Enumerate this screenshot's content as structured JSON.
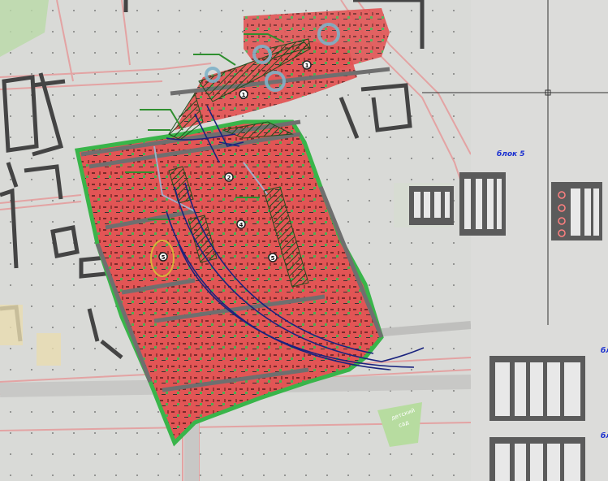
{
  "viewport": {
    "background": "#d6d6d4",
    "paper_color": "#dcdcda"
  },
  "colors": {
    "road_outline": "#e8a6a6",
    "building_outline": "#4a4a4a",
    "site_fill": "#e05a5a",
    "site_edge": "#2f8f2f",
    "hatch_green": "#3d7a3a",
    "route_blue": "#1a237e",
    "circle_cyan": "#7fb2c8",
    "park_green": "#b7dca0",
    "sheet_panel": "#5b5b5b",
    "crosshair": "#333333",
    "label_blue": "#1a2fd0"
  },
  "markers": [
    {
      "id": "1",
      "text": "1"
    },
    {
      "id": "2",
      "text": "1"
    },
    {
      "id": "3",
      "text": "2"
    },
    {
      "id": "4",
      "text": "4"
    },
    {
      "id": "5",
      "text": "5"
    },
    {
      "id": "6",
      "text": "5"
    }
  ],
  "map_labels": {
    "kindergarten_line1": "детский",
    "kindergarten_line2": "сад"
  },
  "sheet_labels": {
    "block_5": "блок 5",
    "right_cut_1": "бл",
    "right_cut_2": "бл"
  }
}
